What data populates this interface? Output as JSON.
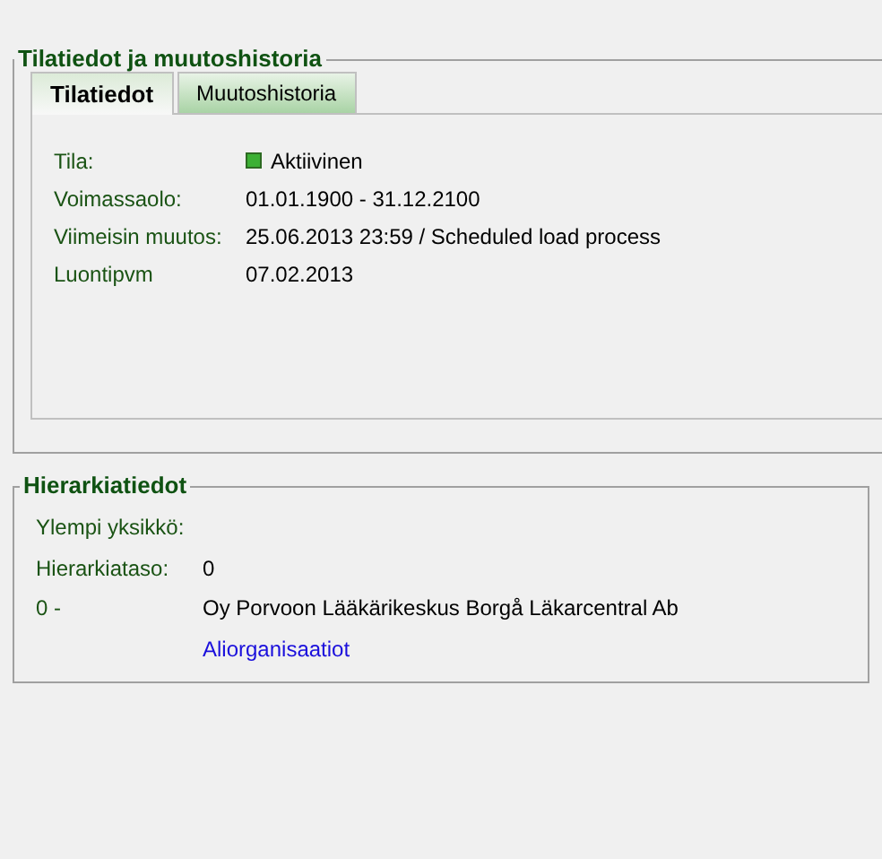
{
  "status_section": {
    "title": "Tilatiedot ja muutoshistoria",
    "tabs": [
      {
        "label": "Tilatiedot",
        "selected": true
      },
      {
        "label": "Muutoshistoria",
        "selected": false
      }
    ],
    "fields": [
      {
        "label": "Tila:",
        "value": "Aktiivinen",
        "kind": "status",
        "color": "#3cb034"
      },
      {
        "label": "Voimassaolo:",
        "value": "01.01.1900 - 31.12.2100",
        "kind": "text"
      },
      {
        "label": "Viimeisin muutos:",
        "value": "25.06.2013 23:59 / Scheduled load process",
        "kind": "text"
      },
      {
        "label": "Luontipvm",
        "value": "07.02.2013",
        "kind": "text"
      }
    ]
  },
  "hierarchy_section": {
    "title": "Hierarkiatiedot",
    "rows": [
      {
        "label": "Ylempi yksikkö:"
      },
      {
        "label": "Hierarkiataso:",
        "value": "0",
        "kind": "text"
      },
      {
        "label": "0 -",
        "value": "Oy Porvoon Lääkärikeskus Borgå Läkarcentral Ab",
        "kind": "text"
      },
      {
        "value": "Aliorganisaatiot",
        "kind": "link"
      }
    ]
  }
}
